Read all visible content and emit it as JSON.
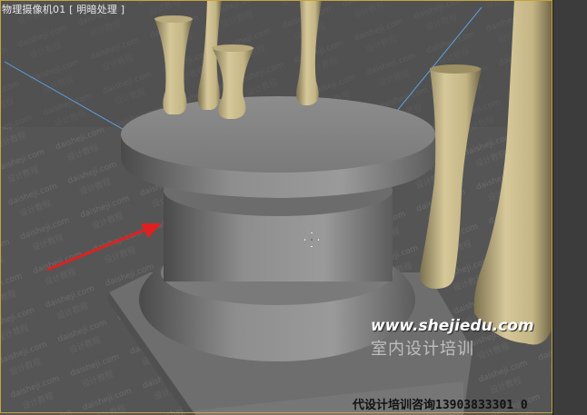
{
  "viewport": {
    "label": "物理摄像机01 [ 明暗处理 ]",
    "border_color": "#c8a23a",
    "background_color": "#5b5b5b"
  },
  "scene": {
    "floor_texture_text": "daisheji.com 设计教程",
    "objects": [
      "pedestal",
      "base-plinth",
      "vase",
      "vase",
      "vase",
      "vase",
      "vase",
      "vase"
    ],
    "object_color": "#c8b98a",
    "pedestal_color": "#8a8a8a",
    "arrow_color": "#e02020",
    "light_ray_color": "#5aa0e0"
  },
  "watermark": {
    "url": "www.shejiedu.com",
    "cn_name": "室内设计培训",
    "phone": "代设计培训咨询13903833301 0"
  },
  "cursor": {
    "icon": "move-cursor-icon"
  }
}
